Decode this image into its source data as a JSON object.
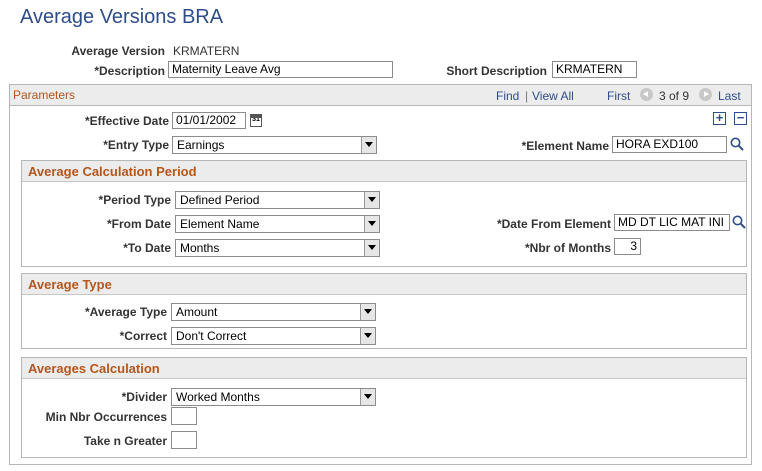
{
  "page": {
    "title": "Average Versions BRA"
  },
  "header": {
    "average_version_label": "Average Version",
    "average_version_value": "KRMATERN",
    "description_label": "*Description",
    "description_value": "Maternity Leave Avg",
    "short_description_label": "Short Description",
    "short_description_value": "KRMATERN"
  },
  "parameters": {
    "title": "Parameters",
    "nav": {
      "find": "Find",
      "view_all": "View All",
      "first": "First",
      "counter": "3 of 9",
      "last": "Last",
      "separator": "|"
    },
    "add_symbol": "+",
    "remove_symbol": "−",
    "effective_date_label": "*Effective Date",
    "effective_date_value": "01/01/2002",
    "calendar_glyph": "31",
    "entry_type_label": "*Entry Type",
    "entry_type_value": "Earnings",
    "element_name_label": "*Element Name",
    "element_name_value": "HORA EXD100"
  },
  "average_calculation_period": {
    "title": "Average Calculation Period",
    "period_type_label": "*Period Type",
    "period_type_value": "Defined Period",
    "from_date_label": "*From Date",
    "from_date_value": "Element Name",
    "date_from_element_label": "*Date From Element",
    "date_from_element_value": "MD DT LIC MAT INI",
    "to_date_label": "*To Date",
    "to_date_value": "Months",
    "nbr_of_months_label": "*Nbr of Months",
    "nbr_of_months_value": "3"
  },
  "average_type": {
    "title": "Average Type",
    "average_type_label": "*Average Type",
    "average_type_value": "Amount",
    "correct_label": "*Correct",
    "correct_value": "Don't Correct"
  },
  "averages_calculation": {
    "title": "Averages Calculation",
    "divider_label": "*Divider",
    "divider_value": "Worked Months",
    "min_nbr_occurrences_label": "Min Nbr Occurrences",
    "min_nbr_occurrences_value": "",
    "take_n_greater_label": "Take n Greater",
    "take_n_greater_value": ""
  },
  "colors": {
    "title": "#2d4d8a",
    "section": "#b4561d",
    "link": "#2d4d8a"
  },
  "icons": {
    "lookup": "magnifier-icon",
    "calendar": "calendar-icon",
    "prev": "previous-arrow-icon",
    "next": "next-arrow-icon"
  }
}
